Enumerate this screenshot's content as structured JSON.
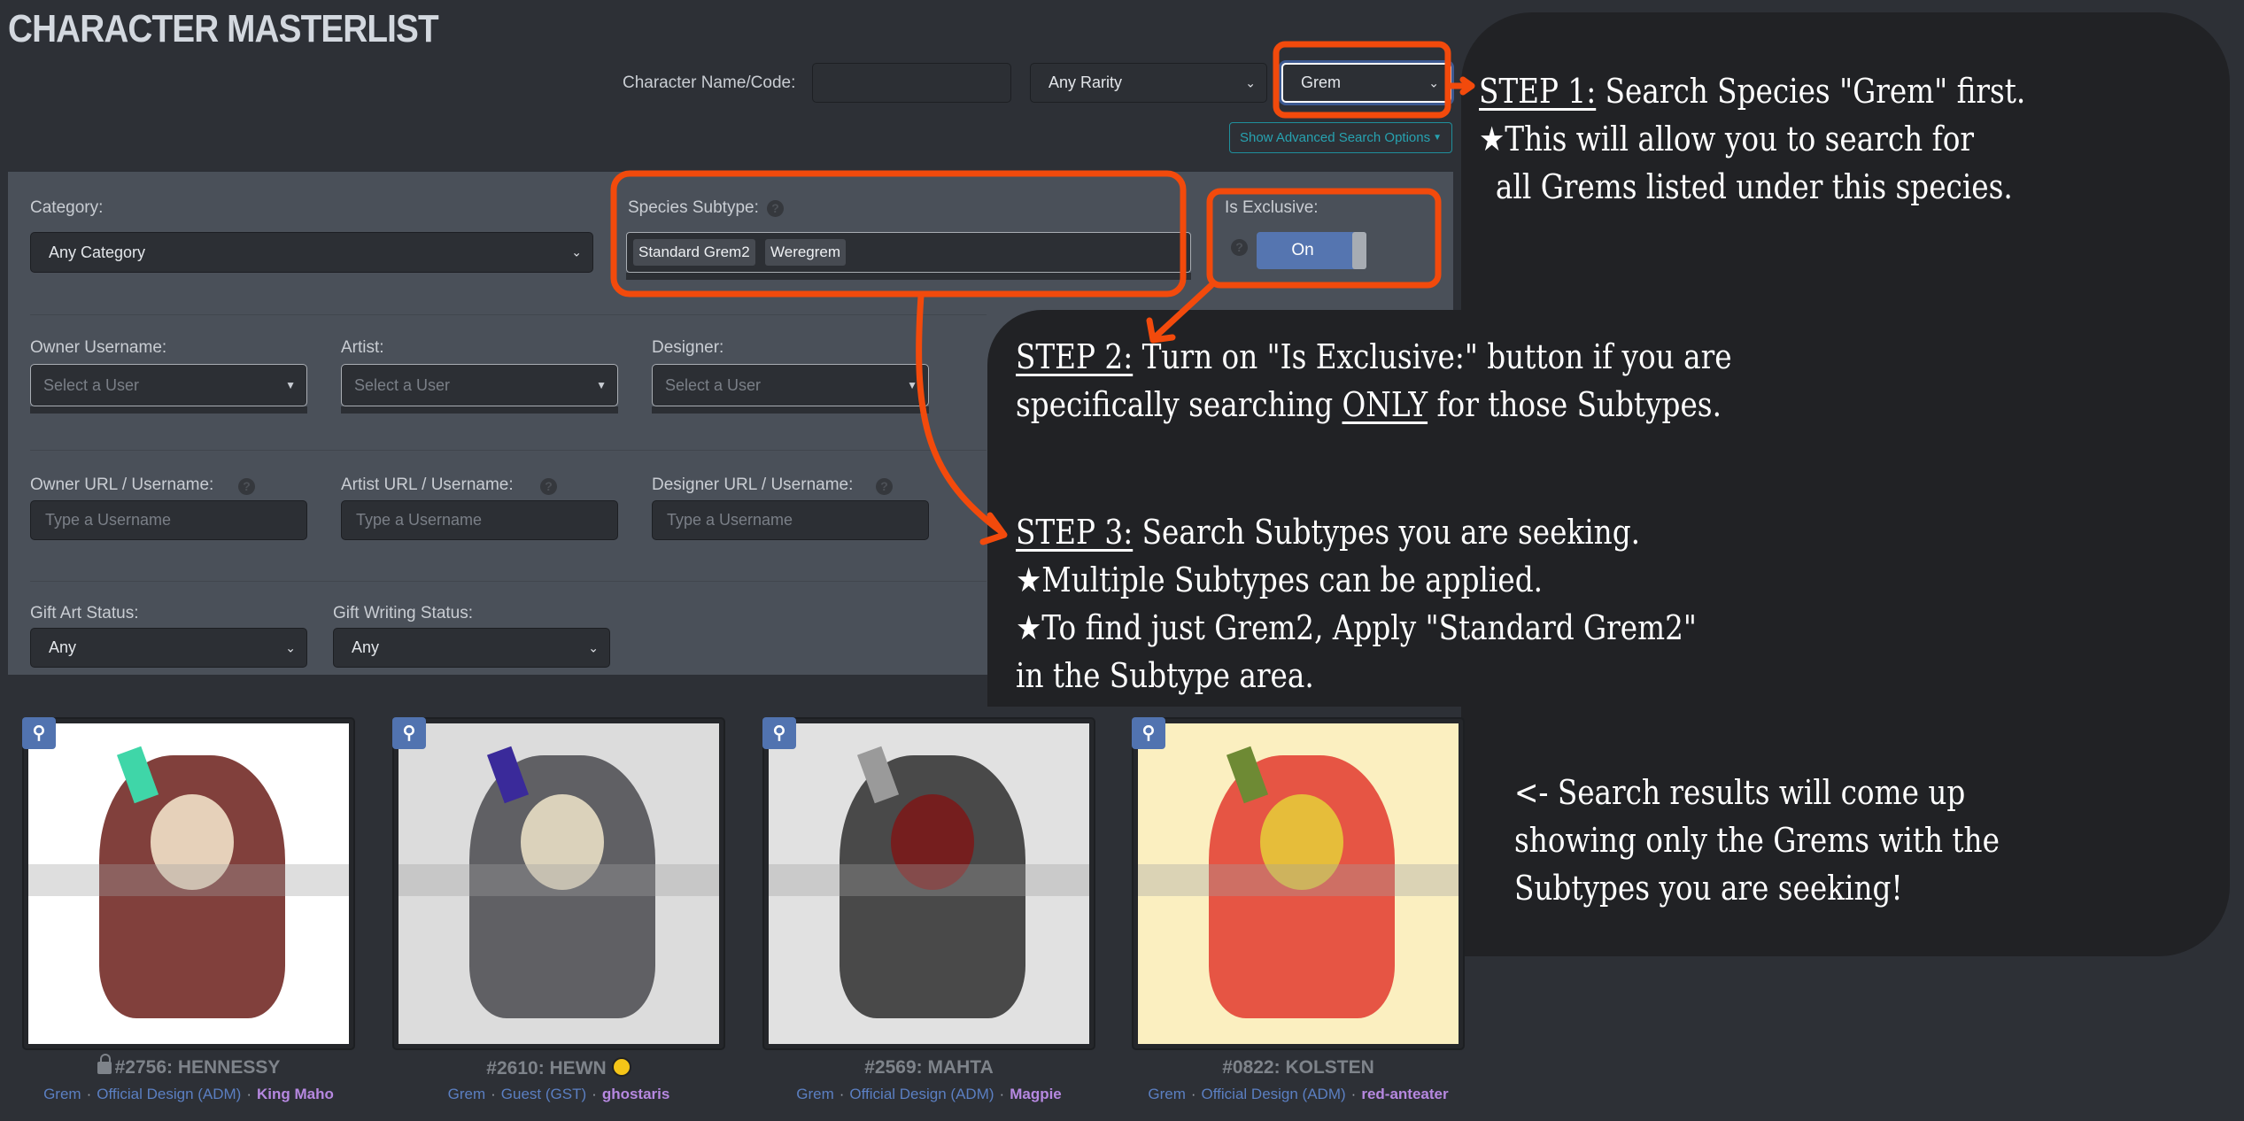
{
  "page": {
    "title": "CHARACTER MASTERLIST"
  },
  "search": {
    "name_label": "Character Name/Code:",
    "name_value": "",
    "rarity_value": "Any Rarity",
    "species_value": "Grem",
    "advanced_toggle_label": "Show Advanced Search Options",
    "advanced_toggle_icon": "caret-down-icon"
  },
  "advanced": {
    "category_label": "Category:",
    "category_value": "Any Category",
    "subtype_label": "Species Subtype:",
    "subtype_chips": [
      "Standard Grem2",
      "Weregrem"
    ],
    "exclusive_label": "Is Exclusive:",
    "exclusive_state": "On",
    "owner_label": "Owner Username:",
    "artist_label": "Artist:",
    "designer_label": "Designer:",
    "user_select_placeholder": "Select a User",
    "owner_url_label": "Owner URL / Username:",
    "artist_url_label": "Artist URL / Username:",
    "designer_url_label": "Designer URL / Username:",
    "url_placeholder": "Type a Username",
    "gift_art_label": "Gift Art Status:",
    "gift_art_value": "Any",
    "gift_writing_label": "Gift Writing Status:",
    "gift_writing_value": "Any",
    "help_glyph": "?"
  },
  "annotations": {
    "step1_head": "STEP 1:",
    "step1_text": " Search Species \"Grem\" first.",
    "step1_line2": "★This will allow you to search for",
    "step1_line3": " all Grems listed under this species.",
    "step2_head": "STEP 2:",
    "step2_text": " Turn on \"Is Exclusive:\" button if you are",
    "step2_line2_a": "specifically searching ",
    "step2_line2_u": "ONLY",
    "step2_line2_b": " for those Subtypes.",
    "step3_head": "STEP 3:",
    "step3_text": " Search Subtypes you are seeking.",
    "step3_line2": "★Multiple Subtypes can be applied.",
    "step3_line3": "★To find just Grem2, Apply \"Standard Grem2\"",
    "step3_line4": "in the Subtype area.",
    "results_line1": "<- Search results will come up",
    "results_line2": "showing only the Grems with the",
    "results_line3": "Subtypes you are seeking!",
    "accent_color": "#f24a0c"
  },
  "results": [
    {
      "title": "#2756: HENNESSY",
      "locked": true,
      "species": "Grem",
      "category": "Official Design (ADM)",
      "owner": "King Maho",
      "palette": [
        "#ffffff",
        "#6b1f1a",
        "#3fd6a8",
        "#f1e1c8"
      ]
    },
    {
      "title": "#2610: HEWN",
      "badge": "coin-icon",
      "species": "Grem",
      "category": "Guest (GST)",
      "owner": "ghostaris",
      "palette": [
        "#dcdcdc",
        "#4a4a4f",
        "#3a2a9a",
        "#e9dfc4"
      ]
    },
    {
      "title": "#2569: MAHTA",
      "species": "Grem",
      "category": "Official Design (ADM)",
      "owner": "Magpie",
      "palette": [
        "#e1e1e1",
        "#2e2e2e",
        "#9a9a9a",
        "#7a1a1a"
      ]
    },
    {
      "title": "#0822: KOLSTEN",
      "species": "Grem",
      "category": "Official Design (ADM)",
      "owner": "red-anteater",
      "palette": [
        "#fbefc0",
        "#e23a2e",
        "#6e8a34",
        "#e6c93a"
      ]
    }
  ],
  "colors": {
    "background": "#2d3036",
    "panel": "#4a5059",
    "link": "#5b7fc2",
    "owner": "#b688e0",
    "toggle_on": "#5575b0"
  }
}
